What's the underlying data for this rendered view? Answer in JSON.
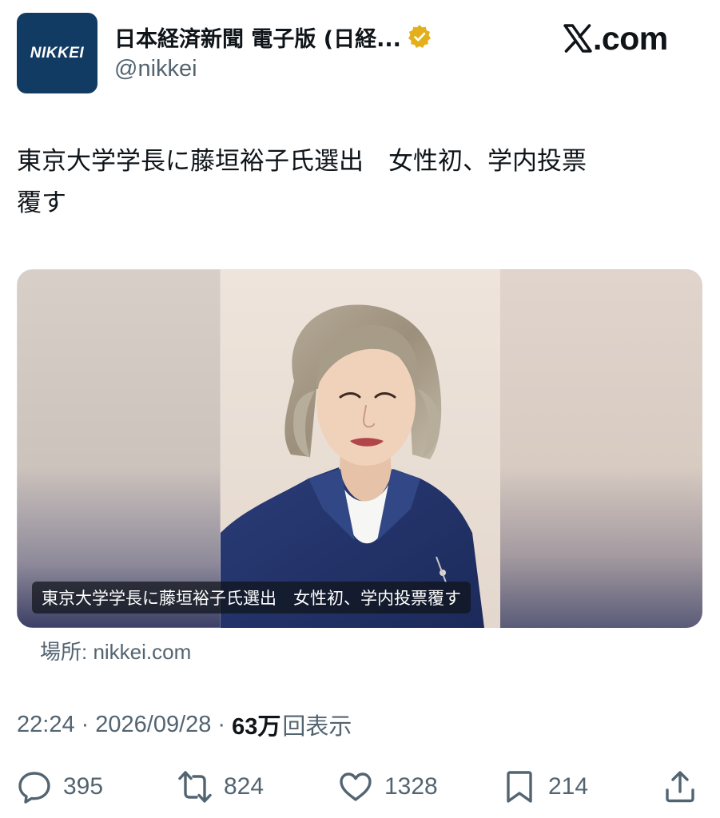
{
  "colors": {
    "brand_navy": "#123b63",
    "verified_gold": "#e3b01b",
    "text_primary": "#0f1419",
    "text_secondary": "#536471"
  },
  "account": {
    "avatar_text": "NIKKEI",
    "display_name": "日本経済新聞 電子版 (日経...",
    "verified_icon": "gold-verified-badge-icon",
    "handle": "@nikkei"
  },
  "site_logo": {
    "icon": "x-logo-icon",
    "domain": ".com"
  },
  "tweet": {
    "text": "東京大学学長に藤垣裕子氏選出　女性初、学内投票\n覆す"
  },
  "card": {
    "caption": "東京大学学長に藤垣裕子氏選出　女性初、学内投票覆す",
    "source_label": "場所: nikkei.com"
  },
  "meta": {
    "time": "22:24",
    "separator": "·",
    "date": "2026/09/28",
    "views_count": "63万",
    "views_label": "回表示"
  },
  "actions": {
    "reply": {
      "icon": "reply-icon",
      "count": "395"
    },
    "repost": {
      "icon": "repost-icon",
      "count": "824"
    },
    "like": {
      "icon": "heart-icon",
      "count": "1328"
    },
    "bookmark": {
      "icon": "bookmark-icon",
      "count": "214"
    },
    "share": {
      "icon": "share-icon"
    }
  }
}
